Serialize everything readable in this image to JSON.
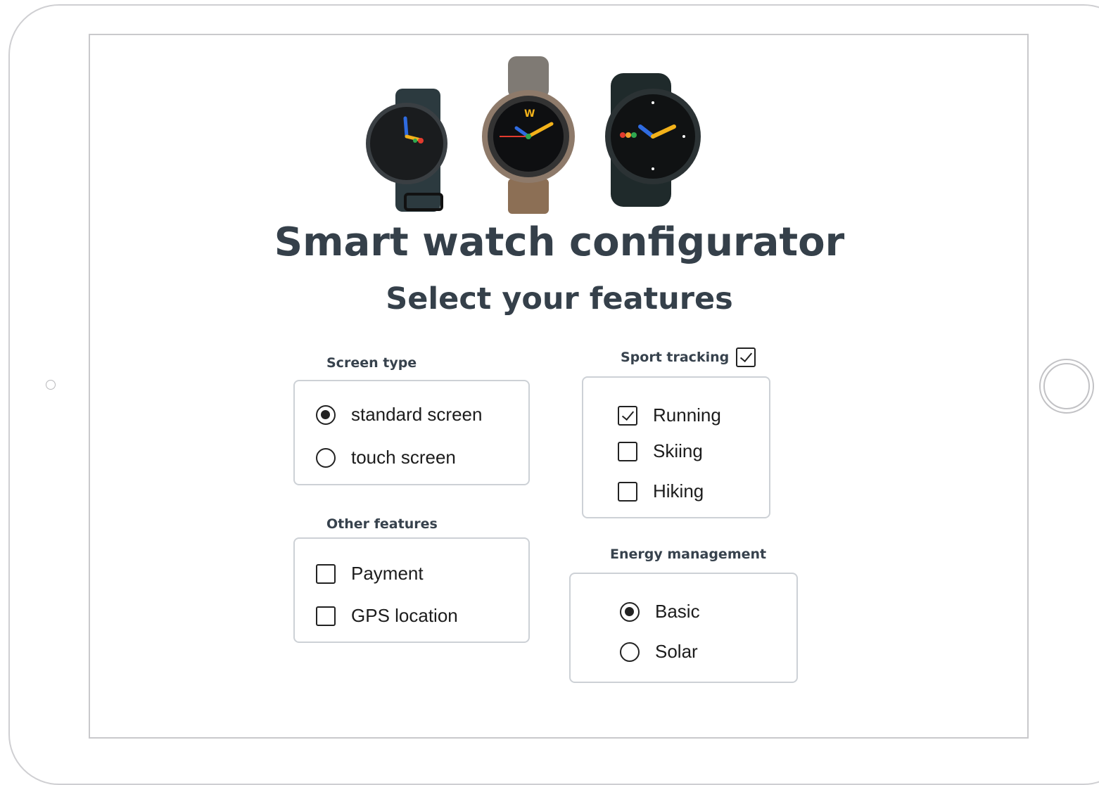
{
  "header": {
    "title": "Smart watch configurator",
    "subtitle": "Select your features"
  },
  "illustration": {
    "icon": "smartwatch-product-images",
    "count": 3
  },
  "groups": {
    "screen_type": {
      "label": "Screen type",
      "options": [
        {
          "label": "standard screen",
          "selected": true
        },
        {
          "label": "touch screen",
          "selected": false
        }
      ]
    },
    "sport_tracking": {
      "label": "Sport tracking",
      "enabled": true,
      "options": [
        {
          "label": "Running",
          "checked": true
        },
        {
          "label": "Skiing",
          "checked": false
        },
        {
          "label": "Hiking",
          "checked": false
        }
      ]
    },
    "other_features": {
      "label": "Other features",
      "options": [
        {
          "label": "Payment",
          "checked": false
        },
        {
          "label": "GPS location",
          "checked": false
        }
      ]
    },
    "energy_management": {
      "label": "Energy management",
      "options": [
        {
          "label": "Basic",
          "selected": true
        },
        {
          "label": "Solar",
          "selected": false
        }
      ]
    }
  },
  "colors": {
    "heading": "#35404a",
    "box_border": "#cdd1d6",
    "tablet_border": "#cfcfd2"
  }
}
